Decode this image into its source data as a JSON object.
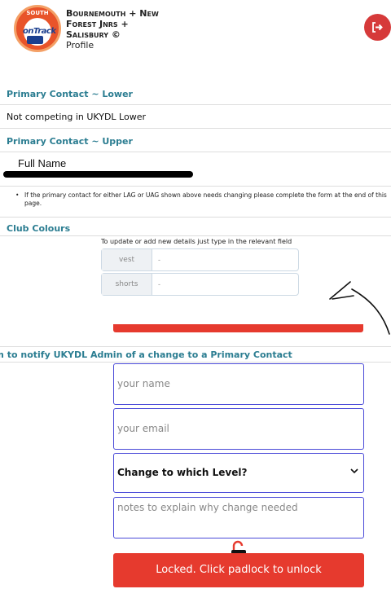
{
  "header": {
    "logo_top_text": "SOUTH",
    "logo_brand_text": "onTrack",
    "org_line1": "Bournemouth + New",
    "org_line2": "Forest Jnrs +",
    "org_line3": "Salisbury ©",
    "profile_label": "Profile",
    "logout_icon": "logout-icon"
  },
  "primary_lower": {
    "title": "Primary Contact ~ Lower",
    "value": "Not competing in UKYDL Lower"
  },
  "primary_upper": {
    "title": "Primary Contact ~ Upper",
    "full_name_label": "Full Name"
  },
  "note": {
    "text": "If the primary contact for either LAG or UAG shown above needs changing please complete the form at the end of this page."
  },
  "club_colours": {
    "title": "Club Colours",
    "hint": "To update or add new details just type in the relevant field",
    "rows": [
      {
        "label": "vest",
        "value": "-"
      },
      {
        "label": "shorts",
        "value": "-"
      }
    ]
  },
  "form": {
    "title": "rm to notify UKYDL Admin of a change to a Primary Contact",
    "name_placeholder": "your name",
    "email_placeholder": "your email",
    "level_selected": "Change to which Level?",
    "notes_placeholder": "notes to explain why change needed",
    "submit_label": "Locked. Click padlock to unlock"
  },
  "colors": {
    "accent_teal": "#2b7d91",
    "button_red": "#e63a2e",
    "input_border": "#4a4ad8"
  }
}
